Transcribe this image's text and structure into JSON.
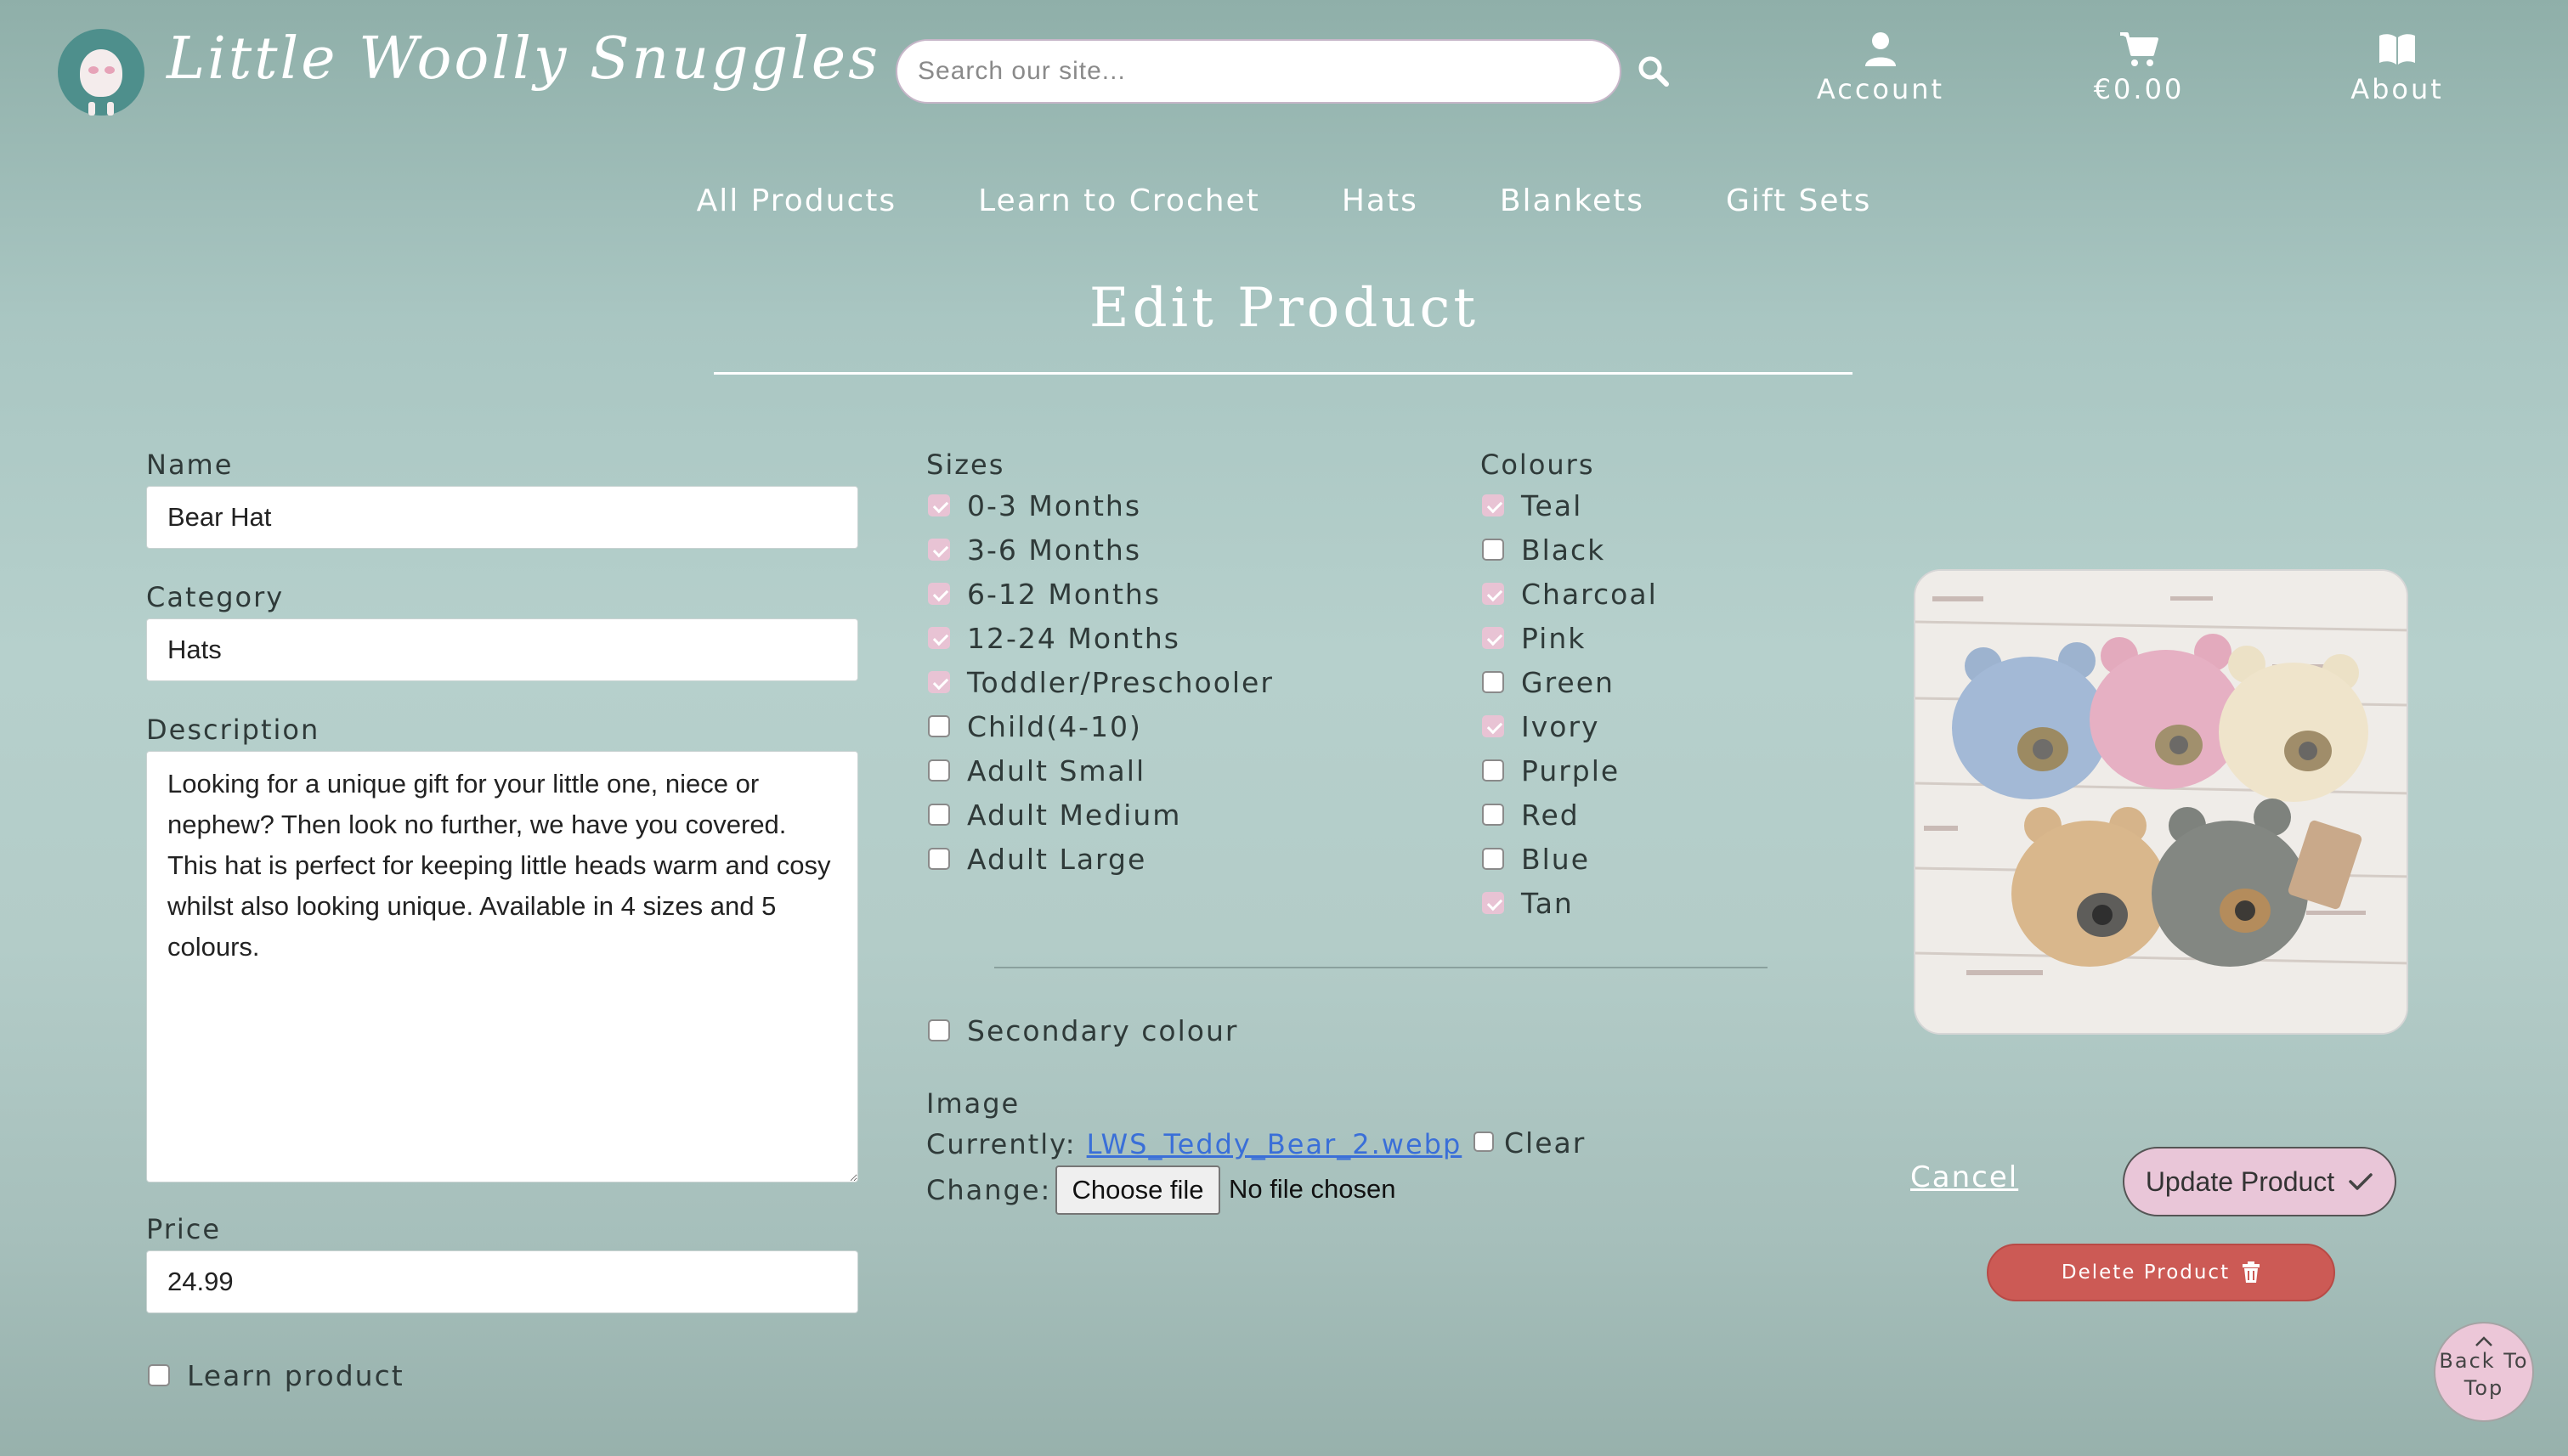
{
  "header": {
    "brand": "Little Woolly Snuggles",
    "search_placeholder": "Search our site...",
    "links": {
      "account": "Account",
      "cart": "€0.00",
      "about": "About"
    }
  },
  "nav": [
    "All Products",
    "Learn to Crochet",
    "Hats",
    "Blankets",
    "Gift Sets"
  ],
  "page_title": "Edit Product",
  "form": {
    "name_label": "Name",
    "name_value": "Bear Hat",
    "category_label": "Category",
    "category_value": "Hats",
    "description_label": "Description",
    "description_value": "Looking for a unique gift for your little one, niece or nephew? Then look no further, we have you covered. This hat is perfect for keeping little heads warm and cosy whilst also looking unique. Available in 4 sizes and 5 colours.",
    "price_label": "Price",
    "price_value": "24.99",
    "learn_product_label": "Learn product",
    "learn_product_checked": false
  },
  "sizes": {
    "label": "Sizes",
    "options": [
      {
        "label": "0-3 Months",
        "checked": true
      },
      {
        "label": "3-6 Months",
        "checked": true
      },
      {
        "label": "6-12 Months",
        "checked": true
      },
      {
        "label": "12-24 Months",
        "checked": true
      },
      {
        "label": "Toddler/Preschooler",
        "checked": true
      },
      {
        "label": "Child(4-10)",
        "checked": false
      },
      {
        "label": "Adult Small",
        "checked": false
      },
      {
        "label": "Adult Medium",
        "checked": false
      },
      {
        "label": "Adult Large",
        "checked": false
      }
    ]
  },
  "colours": {
    "label": "Colours",
    "options": [
      {
        "label": "Teal",
        "checked": true
      },
      {
        "label": "Black",
        "checked": false
      },
      {
        "label": "Charcoal",
        "checked": true
      },
      {
        "label": "Pink",
        "checked": true
      },
      {
        "label": "Green",
        "checked": false
      },
      {
        "label": "Ivory",
        "checked": true
      },
      {
        "label": "Purple",
        "checked": false
      },
      {
        "label": "Red",
        "checked": false
      },
      {
        "label": "Blue",
        "checked": false
      },
      {
        "label": "Tan",
        "checked": true
      }
    ]
  },
  "secondary_colour": {
    "label": "Secondary colour",
    "checked": false
  },
  "image": {
    "label": "Image",
    "currently_label": "Currently:",
    "current_file": "LWS_Teddy_Bear_2.webp",
    "clear_label": "Clear",
    "change_label": "Change:",
    "choose_label": "Choose file",
    "no_file_label": "No file chosen"
  },
  "actions": {
    "cancel": "Cancel",
    "update": "Update Product",
    "delete": "Delete Product",
    "back_to_top_1": "Back To",
    "back_to_top_2": "Top"
  },
  "colors": {
    "accent_pink": "#e8c3d4",
    "delete_red": "#cc5a55",
    "logo_teal": "#4e8f8c"
  }
}
